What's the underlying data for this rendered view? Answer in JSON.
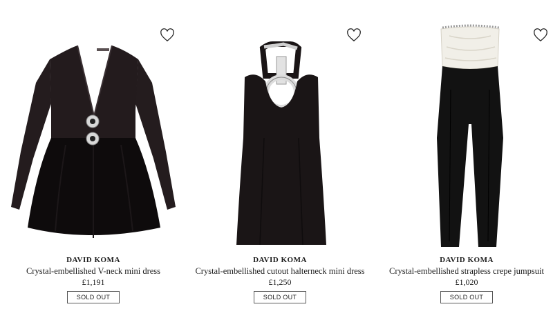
{
  "products": [
    {
      "brand": "DAVID KOMA",
      "name": "Crystal-embellished V-neck mini dress",
      "price": "£1,191",
      "status": "SOLD OUT",
      "wishlist_icon": "heart-outline-icon",
      "garment_color": "#1c1618"
    },
    {
      "brand": "DAVID KOMA",
      "name": "Crystal-embellished cutout halterneck mini dress",
      "price": "£1,250",
      "status": "SOLD OUT",
      "wishlist_icon": "heart-outline-icon",
      "garment_color": "#1a1516"
    },
    {
      "brand": "DAVID KOMA",
      "name": "Crystal-embellished strapless crepe jumpsuit",
      "price": "£1,020",
      "status": "SOLD OUT",
      "wishlist_icon": "heart-outline-icon",
      "garment_color": "#121212"
    }
  ]
}
